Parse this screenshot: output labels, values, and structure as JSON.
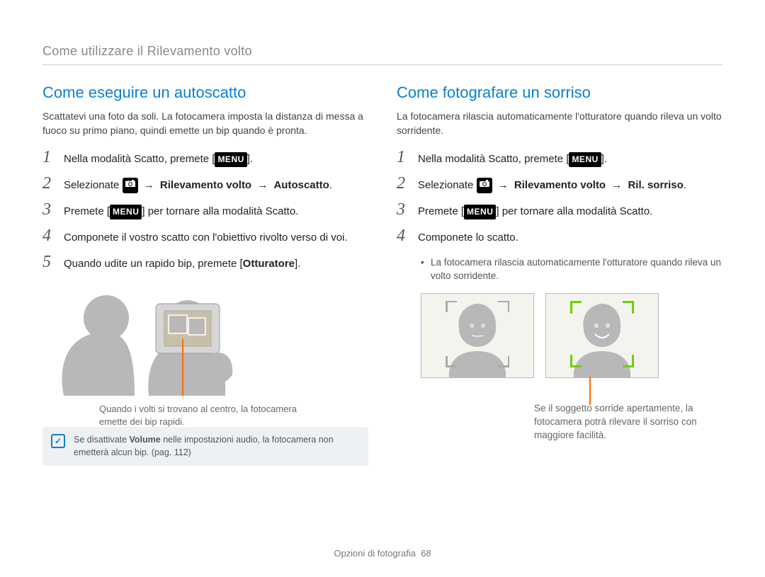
{
  "header": "Come utilizzare il Rilevamento volto",
  "left": {
    "title": "Come eseguire un autoscatto",
    "intro": "Scattatevi una foto da soli. La fotocamera imposta la distanza di messa a fuoco su primo piano, quindi emette un bip quando è pronta.",
    "steps": {
      "s1_pre": "Nella modalità Scatto, premete [",
      "s1_icon": "MENU",
      "s1_post": "].",
      "s2_pre": "Selezionate ",
      "s2_chain1": "Rilevamento volto",
      "s2_chain2": "Autoscatto",
      "s3_pre": "Premete [",
      "s3_post": "] per tornare alla modalità Scatto.",
      "s4": "Componete il vostro scatto con l'obiettivo rivolto verso di voi.",
      "s5_pre": "Quando udite un rapido bip, premete [",
      "s5_bold": "Otturatore",
      "s5_post": "]."
    },
    "callout": "Quando i volti si trovano al centro, la fotocamera emette dei bip rapidi.",
    "info_pre": "Se disattivate ",
    "info_bold": "Volume",
    "info_post": " nelle impostazioni audio, la fotocamera non emetterà alcun bip. (pag. 112)"
  },
  "right": {
    "title": "Come fotografare un sorriso",
    "intro": "La fotocamera rilascia automaticamente l'otturatore quando rileva un volto sorridente.",
    "steps": {
      "s1_pre": "Nella modalità Scatto, premete [",
      "s1_post": "].",
      "s2_pre": "Selezionate ",
      "s2_chain1": "Rilevamento volto",
      "s2_chain2": "Ril. sorriso",
      "s3_pre": "Premete [",
      "s3_post": "] per tornare alla modalità Scatto.",
      "s4": "Componete lo scatto."
    },
    "bullet": "La fotocamera rilascia automaticamente l'otturatore quando rileva un volto sorridente.",
    "callout": "Se il soggetto sorride apertamente, la fotocamera potrà rilevare il sorriso con maggiore facilità."
  },
  "footer_label": "Opzioni di fotografia",
  "footer_page": "68",
  "arrow": "→"
}
